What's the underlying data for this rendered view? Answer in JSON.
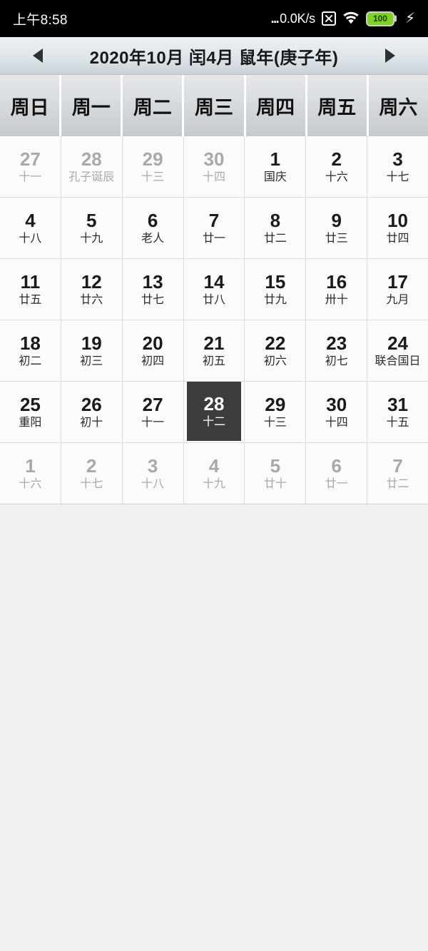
{
  "status_bar": {
    "clock": "上午8:58",
    "network_speed": "0.0K/s",
    "speed_prefix": "...",
    "xbox_icon": "x-in-box-icon",
    "wifi_icon": "wifi-icon",
    "battery_level": "100",
    "charging_icon": "⚡"
  },
  "header": {
    "prev_label": "◀",
    "next_label": "▶",
    "title": "2020年10月 闰4月 鼠年(庚子年)",
    "gregorian_year": "2020年",
    "gregorian_month": "10月",
    "leap_month": "闰4月",
    "zodiac_year": "鼠年(庚子年)"
  },
  "weekdays": [
    "周日",
    "周一",
    "周二",
    "周三",
    "周四",
    "周五",
    "周六"
  ],
  "colors": {
    "selected_bg": "#3c3c3c",
    "selected_text": "#ffffff",
    "current_month_text": "#1a1a1a",
    "other_month_text": "#a9a9a9",
    "battery_green": "#7ed321",
    "status_bar_bg": "#000000",
    "header_gradient_top": "#eef1f3",
    "header_gradient_bottom": "#c9d2d8"
  },
  "days": [
    {
      "num": "27",
      "lunar": "十一",
      "month": "prev",
      "selected": false
    },
    {
      "num": "28",
      "lunar": "孔子诞辰",
      "month": "prev",
      "selected": false
    },
    {
      "num": "29",
      "lunar": "十三",
      "month": "prev",
      "selected": false
    },
    {
      "num": "30",
      "lunar": "十四",
      "month": "prev",
      "selected": false
    },
    {
      "num": "1",
      "lunar": "国庆",
      "month": "current",
      "selected": false
    },
    {
      "num": "2",
      "lunar": "十六",
      "month": "current",
      "selected": false
    },
    {
      "num": "3",
      "lunar": "十七",
      "month": "current",
      "selected": false
    },
    {
      "num": "4",
      "lunar": "十八",
      "month": "current",
      "selected": false
    },
    {
      "num": "5",
      "lunar": "十九",
      "month": "current",
      "selected": false
    },
    {
      "num": "6",
      "lunar": "老人",
      "month": "current",
      "selected": false
    },
    {
      "num": "7",
      "lunar": "廿一",
      "month": "current",
      "selected": false
    },
    {
      "num": "8",
      "lunar": "廿二",
      "month": "current",
      "selected": false
    },
    {
      "num": "9",
      "lunar": "廿三",
      "month": "current",
      "selected": false
    },
    {
      "num": "10",
      "lunar": "廿四",
      "month": "current",
      "selected": false
    },
    {
      "num": "11",
      "lunar": "廿五",
      "month": "current",
      "selected": false
    },
    {
      "num": "12",
      "lunar": "廿六",
      "month": "current",
      "selected": false
    },
    {
      "num": "13",
      "lunar": "廿七",
      "month": "current",
      "selected": false
    },
    {
      "num": "14",
      "lunar": "廿八",
      "month": "current",
      "selected": false
    },
    {
      "num": "15",
      "lunar": "廿九",
      "month": "current",
      "selected": false
    },
    {
      "num": "16",
      "lunar": "卅十",
      "month": "current",
      "selected": false
    },
    {
      "num": "17",
      "lunar": "九月",
      "month": "current",
      "selected": false
    },
    {
      "num": "18",
      "lunar": "初二",
      "month": "current",
      "selected": false
    },
    {
      "num": "19",
      "lunar": "初三",
      "month": "current",
      "selected": false
    },
    {
      "num": "20",
      "lunar": "初四",
      "month": "current",
      "selected": false
    },
    {
      "num": "21",
      "lunar": "初五",
      "month": "current",
      "selected": false
    },
    {
      "num": "22",
      "lunar": "初六",
      "month": "current",
      "selected": false
    },
    {
      "num": "23",
      "lunar": "初七",
      "month": "current",
      "selected": false
    },
    {
      "num": "24",
      "lunar": "联合国日",
      "month": "current",
      "selected": false
    },
    {
      "num": "25",
      "lunar": "重阳",
      "month": "current",
      "selected": false
    },
    {
      "num": "26",
      "lunar": "初十",
      "month": "current",
      "selected": false
    },
    {
      "num": "27",
      "lunar": "十一",
      "month": "current",
      "selected": false
    },
    {
      "num": "28",
      "lunar": "十二",
      "month": "current",
      "selected": true
    },
    {
      "num": "29",
      "lunar": "十三",
      "month": "current",
      "selected": false
    },
    {
      "num": "30",
      "lunar": "十四",
      "month": "current",
      "selected": false
    },
    {
      "num": "31",
      "lunar": "十五",
      "month": "current",
      "selected": false
    },
    {
      "num": "1",
      "lunar": "十六",
      "month": "next",
      "selected": false
    },
    {
      "num": "2",
      "lunar": "十七",
      "month": "next",
      "selected": false
    },
    {
      "num": "3",
      "lunar": "十八",
      "month": "next",
      "selected": false
    },
    {
      "num": "4",
      "lunar": "十九",
      "month": "next",
      "selected": false
    },
    {
      "num": "5",
      "lunar": "廿十",
      "month": "next",
      "selected": false
    },
    {
      "num": "6",
      "lunar": "廿一",
      "month": "next",
      "selected": false
    },
    {
      "num": "7",
      "lunar": "廿二",
      "month": "next",
      "selected": false
    }
  ]
}
